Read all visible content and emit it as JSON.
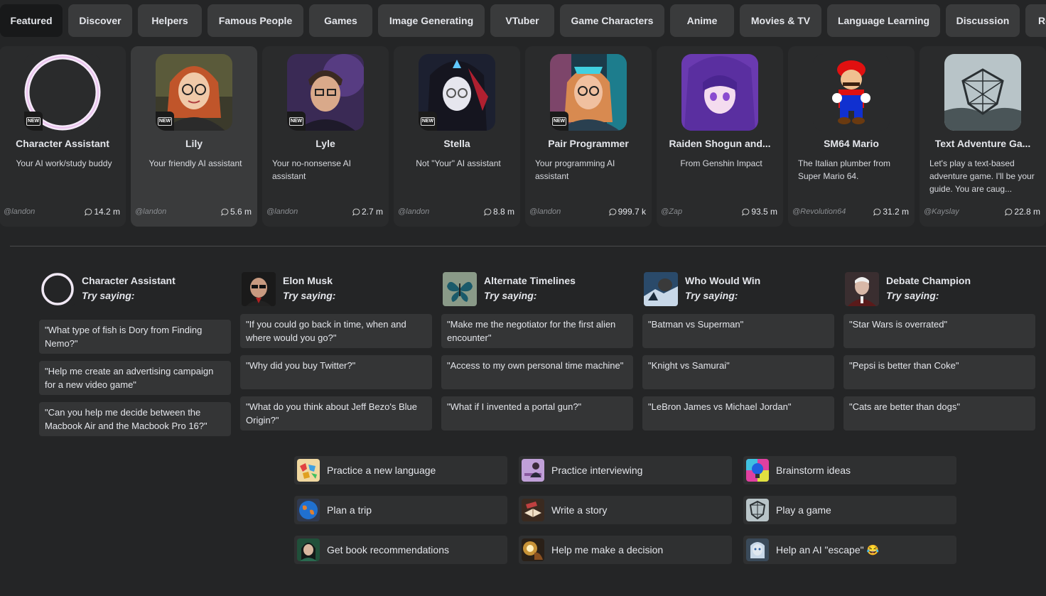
{
  "tabs": [
    "Featured",
    "Discover",
    "Helpers",
    "Famous People",
    "Games",
    "Image Generating",
    "VTuber",
    "Game Characters",
    "Anime",
    "Movies & TV",
    "Language Learning",
    "Discussion",
    "Re"
  ],
  "badge_text": "NEW",
  "characters": [
    {
      "name": "Character Assistant",
      "description": "Your AI work/study buddy",
      "author": "@landon",
      "count": "14.2 m",
      "icon": "ring-avatar"
    },
    {
      "name": "Lily",
      "description": "Your friendly AI assistant",
      "author": "@landon",
      "count": "5.6 m",
      "icon": "lily-avatar"
    },
    {
      "name": "Lyle",
      "description": "Your no-nonsense AI assistant",
      "author": "@landon",
      "count": "2.7 m",
      "icon": "lyle-avatar"
    },
    {
      "name": "Stella",
      "description": "Not \"Your\" AI assistant",
      "author": "@landon",
      "count": "8.8 m",
      "icon": "stella-avatar"
    },
    {
      "name": "Pair Programmer",
      "description": "Your programming AI assistant",
      "author": "@landon",
      "count": "999.7 k",
      "icon": "programmer-avatar"
    },
    {
      "name": "Raiden Shogun and...",
      "description": "From Genshin Impact",
      "author": "@Zap",
      "count": "93.5 m",
      "icon": "raiden-avatar"
    },
    {
      "name": "SM64 Mario",
      "description": "The Italian plumber from Super Mario 64.",
      "author": "@Revolution64",
      "count": "31.2 m",
      "icon": "mario-avatar"
    },
    {
      "name": "Text Adventure Ga...",
      "description": "Let's play a text-based adventure game. I'll be your guide. You are caug...",
      "author": "@Kayslay",
      "count": "22.8 m",
      "icon": "adventure-avatar"
    }
  ],
  "try_saying_label": "Try saying:",
  "columns": [
    {
      "title": "Character Assistant",
      "prompts": [
        "\"What type of fish is Dory from Finding Nemo?\"",
        "\"Help me create an advertising campaign for a new video game\"",
        "\"Can you help me decide between the Macbook Air and the Macbook Pro 16?\""
      ]
    },
    {
      "title": "Elon Musk",
      "prompts": [
        "\"If you could go back in time, when and where would you go?\"",
        "\"Why did you buy Twitter?\"",
        "\"What do you think about Jeff Bezo's Blue Origin?\""
      ]
    },
    {
      "title": "Alternate Timelines",
      "prompts": [
        "\"Make me the negotiator for the first alien encounter\"",
        "\"Access to my own personal time machine\"",
        "\"What if I invented a portal gun?\""
      ]
    },
    {
      "title": "Who Would Win",
      "prompts": [
        "\"Batman vs Superman\"",
        "\"Knight vs Samurai\"",
        "\"LeBron James vs Michael Jordan\""
      ]
    },
    {
      "title": "Debate Champion",
      "prompts": [
        "\"Star Wars is overrated\"",
        "\"Pepsi is better than Coke\"",
        "\"Cats are better than dogs\""
      ]
    }
  ],
  "suggestions": [
    {
      "label": "Practice a new language",
      "icon": "world-map-icon"
    },
    {
      "label": "Practice interviewing",
      "icon": "interview-icon"
    },
    {
      "label": "Brainstorm ideas",
      "icon": "lightbulb-icon"
    },
    {
      "label": "Plan a trip",
      "icon": "globe-icon"
    },
    {
      "label": "Write a story",
      "icon": "book-icon"
    },
    {
      "label": "Play a game",
      "icon": "shield-game-icon"
    },
    {
      "label": "Get book recommendations",
      "icon": "reader-icon"
    },
    {
      "label": "Help me make a decision",
      "icon": "lamp-icon"
    },
    {
      "label": "Help an AI \"escape\" 😂",
      "icon": "robot-face-icon"
    }
  ]
}
